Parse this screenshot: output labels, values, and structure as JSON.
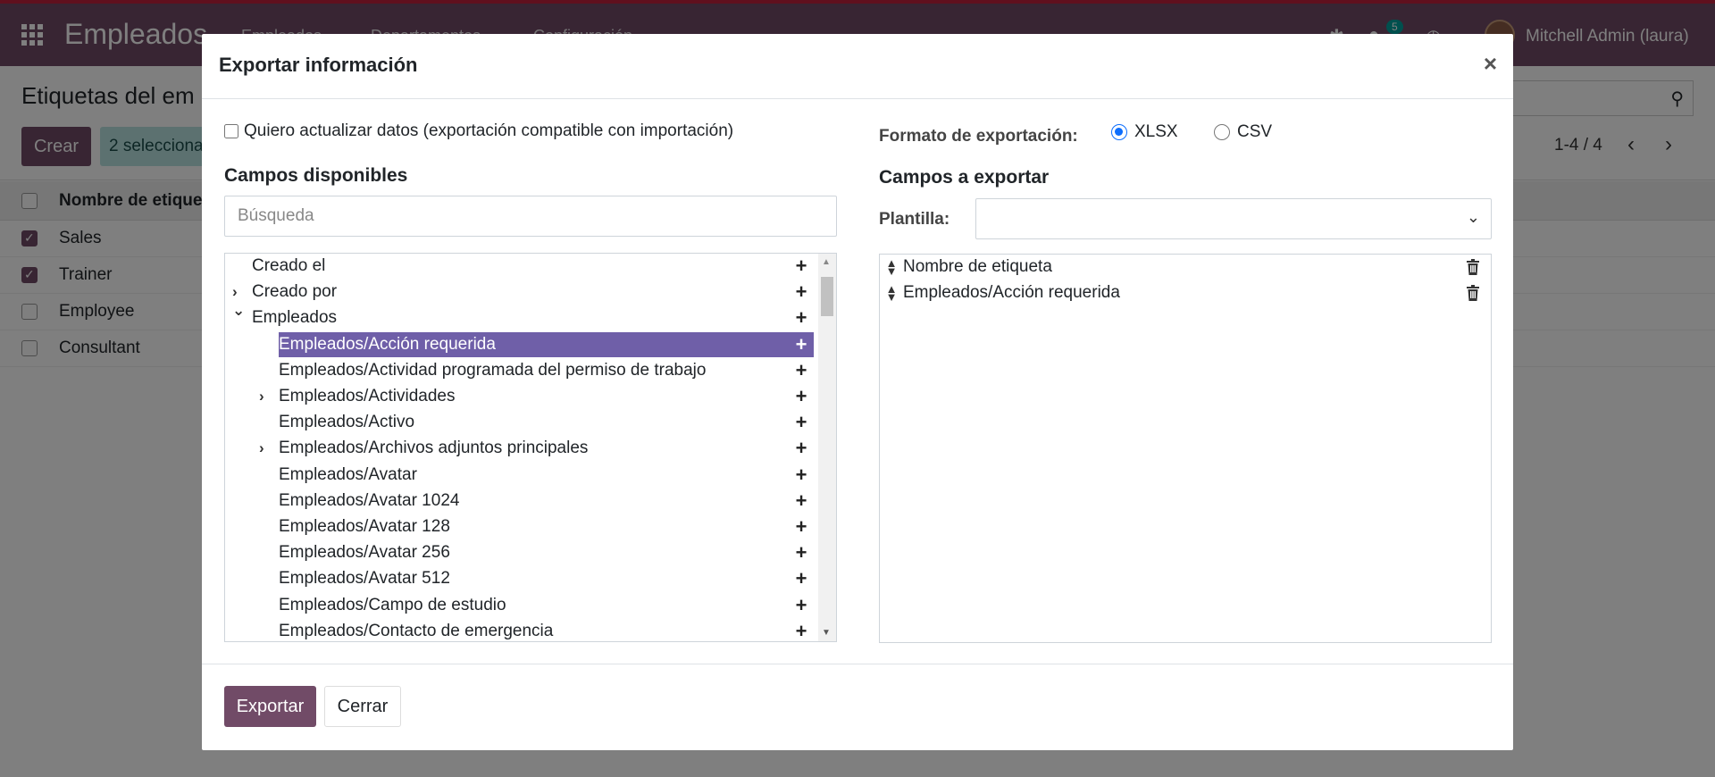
{
  "app": {
    "brand": "Empleados",
    "menu": [
      "Empleados",
      "Departamentos",
      "Configuración"
    ],
    "badge_count": "5",
    "user": "Mitchell Admin (laura)"
  },
  "control_panel": {
    "title": "Etiquetas del em",
    "create_label": "Crear",
    "selected_label": "2 selecciona",
    "pager": "1-4 / 4"
  },
  "list": {
    "header": "Nombre de etique",
    "rows": [
      {
        "label": "Sales",
        "checked": true
      },
      {
        "label": "Trainer",
        "checked": true
      },
      {
        "label": "Employee",
        "checked": false
      },
      {
        "label": "Consultant",
        "checked": false
      }
    ]
  },
  "modal": {
    "title": "Exportar información",
    "close_glyph": "×",
    "compat_label": "Quiero actualizar datos (exportación compatible con importación)",
    "available_title": "Campos disponibles",
    "search_placeholder": "Búsqueda",
    "tree": [
      {
        "label": "Creado el",
        "chevron": "",
        "level": 0,
        "selected": false
      },
      {
        "label": "Creado por",
        "chevron": "right",
        "level": 0,
        "selected": false
      },
      {
        "label": "Empleados",
        "chevron": "down",
        "level": 0,
        "selected": false
      },
      {
        "label": "Empleados/Acción requerida",
        "chevron": "",
        "level": 1,
        "selected": true
      },
      {
        "label": "Empleados/Actividad programada del permiso de trabajo",
        "chevron": "",
        "level": 1,
        "selected": false
      },
      {
        "label": "Empleados/Actividades",
        "chevron": "right",
        "level": 1,
        "selected": false
      },
      {
        "label": "Empleados/Activo",
        "chevron": "",
        "level": 1,
        "selected": false
      },
      {
        "label": "Empleados/Archivos adjuntos principales",
        "chevron": "right",
        "level": 1,
        "selected": false
      },
      {
        "label": "Empleados/Avatar",
        "chevron": "",
        "level": 1,
        "selected": false
      },
      {
        "label": "Empleados/Avatar 1024",
        "chevron": "",
        "level": 1,
        "selected": false
      },
      {
        "label": "Empleados/Avatar 128",
        "chevron": "",
        "level": 1,
        "selected": false
      },
      {
        "label": "Empleados/Avatar 256",
        "chevron": "",
        "level": 1,
        "selected": false
      },
      {
        "label": "Empleados/Avatar 512",
        "chevron": "",
        "level": 1,
        "selected": false
      },
      {
        "label": "Empleados/Campo de estudio",
        "chevron": "",
        "level": 1,
        "selected": false
      },
      {
        "label": "Empleados/Contacto de emergencia",
        "chevron": "",
        "level": 1,
        "selected": false
      }
    ],
    "format_label": "Formato de exportación:",
    "formats": [
      {
        "label": "XLSX",
        "selected": true
      },
      {
        "label": "CSV",
        "selected": false
      }
    ],
    "export_title": "Campos a exportar",
    "template_label": "Plantilla:",
    "template_value": "",
    "export_fields": [
      "Nombre de etiqueta",
      "Empleados/Acción requerida"
    ],
    "export_button": "Exportar",
    "close_button": "Cerrar"
  },
  "colors": {
    "brand": "#714b67",
    "selected_row": "#6f5fa8",
    "radio_on": "#0d6efd"
  }
}
